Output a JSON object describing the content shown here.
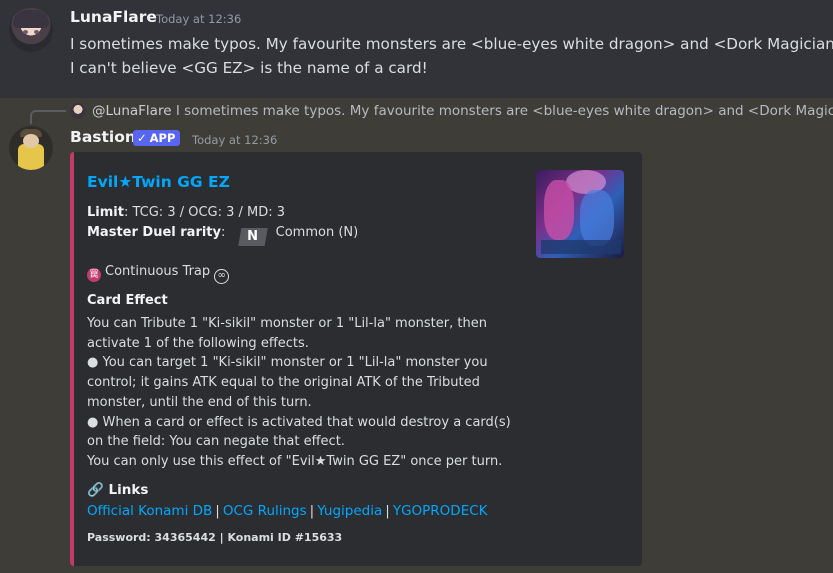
{
  "message1": {
    "username": "LunaFlare",
    "timestamp": "Today at 12:36",
    "line1": "I sometimes make typos. My favourite monsters are <blue-eyes white dragon> and <Dork Magician>.",
    "line2": "I can't believe <GG EZ> is the name of a card!"
  },
  "reply": {
    "mention": "@LunaFlare",
    "text": "I sometimes make typos. My favourite monsters are <blue-eyes white dragon> and <Dork Magician>."
  },
  "message2": {
    "username": "Bastion",
    "app_tag": "APP",
    "check_glyph": "✓",
    "timestamp": "Today at 12:36"
  },
  "embed": {
    "accent_color": "#c13a68",
    "title": "Evil★Twin GG EZ",
    "limit_label": "Limit",
    "limit_value": ": TCG: 3 / OCG: 3 / MD: 3",
    "rarity_label": "Master Duel rarity",
    "rarity_badge": "N",
    "rarity_value": "Common (N)",
    "trap_icon_glyph": "罠",
    "card_type": "Continuous Trap",
    "continuous_icon_glyph": "∞",
    "effect_heading": "Card Effect",
    "effect_lines": [
      "You can Tribute 1 \"Ki-sikil\" monster or 1 \"Lil-la\" monster, then",
      "activate 1 of the following effects.",
      "● You can target 1 \"Ki-sikil\" monster or 1 \"Lil-la\" monster you",
      "control; it gains ATK equal to the original ATK of the Tributed",
      "monster, until the end of this turn.",
      "● When a card or effect is activated that would destroy a card(s)",
      "on the field: You can negate that effect.",
      "You can only use this effect of \"Evil★Twin GG EZ\" once per turn."
    ],
    "links_icon": "🔗",
    "links_heading": "Links",
    "links": [
      "Official Konami DB",
      "OCG Rulings",
      "Yugipedia",
      "YGOPRODECK"
    ],
    "link_separator": "|",
    "footer": "Password: 34365442 | Konami ID #15633"
  }
}
